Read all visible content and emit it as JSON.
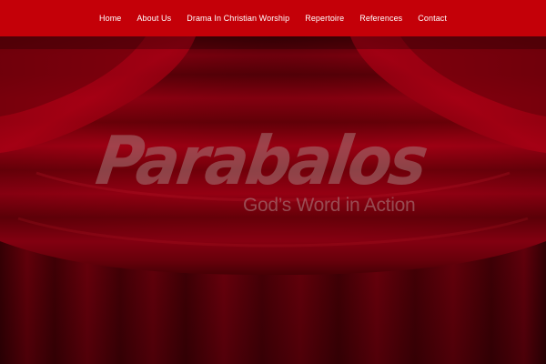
{
  "nav": {
    "items": [
      {
        "label": "Home"
      },
      {
        "label": "About Us"
      },
      {
        "label": "Drama In Christian Worship"
      },
      {
        "label": "Repertoire"
      },
      {
        "label": "References"
      },
      {
        "label": "Contact"
      }
    ]
  },
  "hero": {
    "logo_text": "Parabalos",
    "tagline": "God’s Word in Action"
  },
  "colors": {
    "nav_background": "#c40008",
    "nav_text": "#ffffff",
    "curtain_red": "#9a0010",
    "curtain_dark": "#3a0004",
    "logo_overlay": "#a5787a"
  }
}
